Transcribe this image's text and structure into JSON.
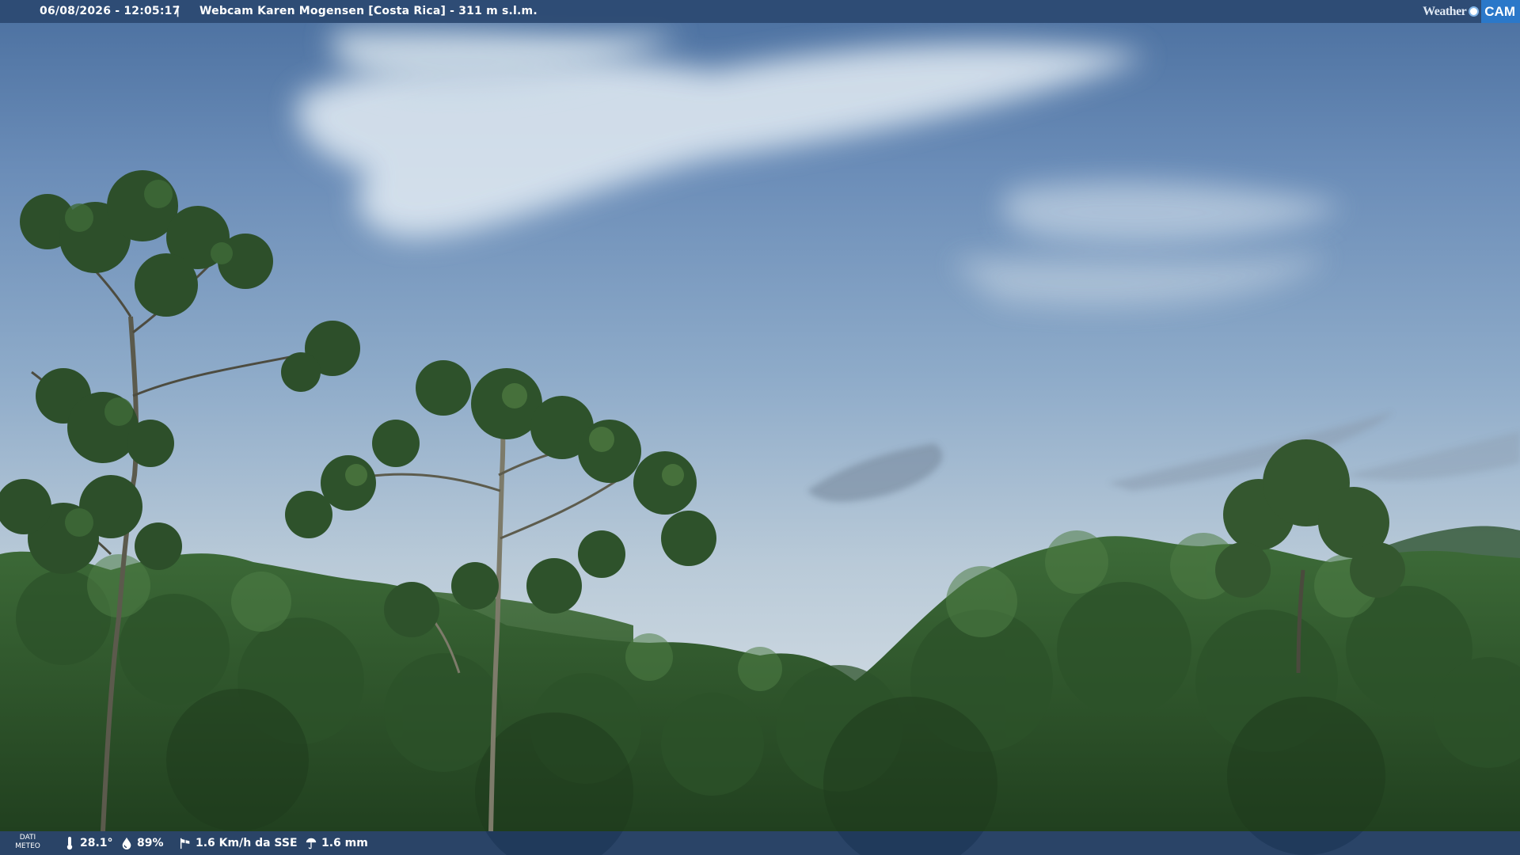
{
  "header": {
    "datetime": "06/08/2026 - 12:05:17",
    "separator": "|",
    "title": "Webcam Karen Mogensen [Costa Rica] - 311 m s.l.m.",
    "logo_left": "Weather",
    "logo_right": "CAM"
  },
  "footer": {
    "label_line1": "DATI",
    "label_line2": "METEO",
    "temperature": "28.1°",
    "humidity": "89%",
    "wind": "1.6 Km/h da SSE",
    "rain": "1.6 mm"
  },
  "icons": {
    "temperature": "thermometer-icon",
    "humidity": "droplet-icon",
    "wind": "wind-sock-icon",
    "rain": "rain-icon"
  },
  "colors": {
    "top_bar": "#2b4971",
    "bottom_bar": "#143056",
    "logo_accent": "#2b78c9",
    "sky_top": "#4a6f9f",
    "sky_horizon": "#cbd7e0",
    "foliage": "#2f5a2c"
  }
}
